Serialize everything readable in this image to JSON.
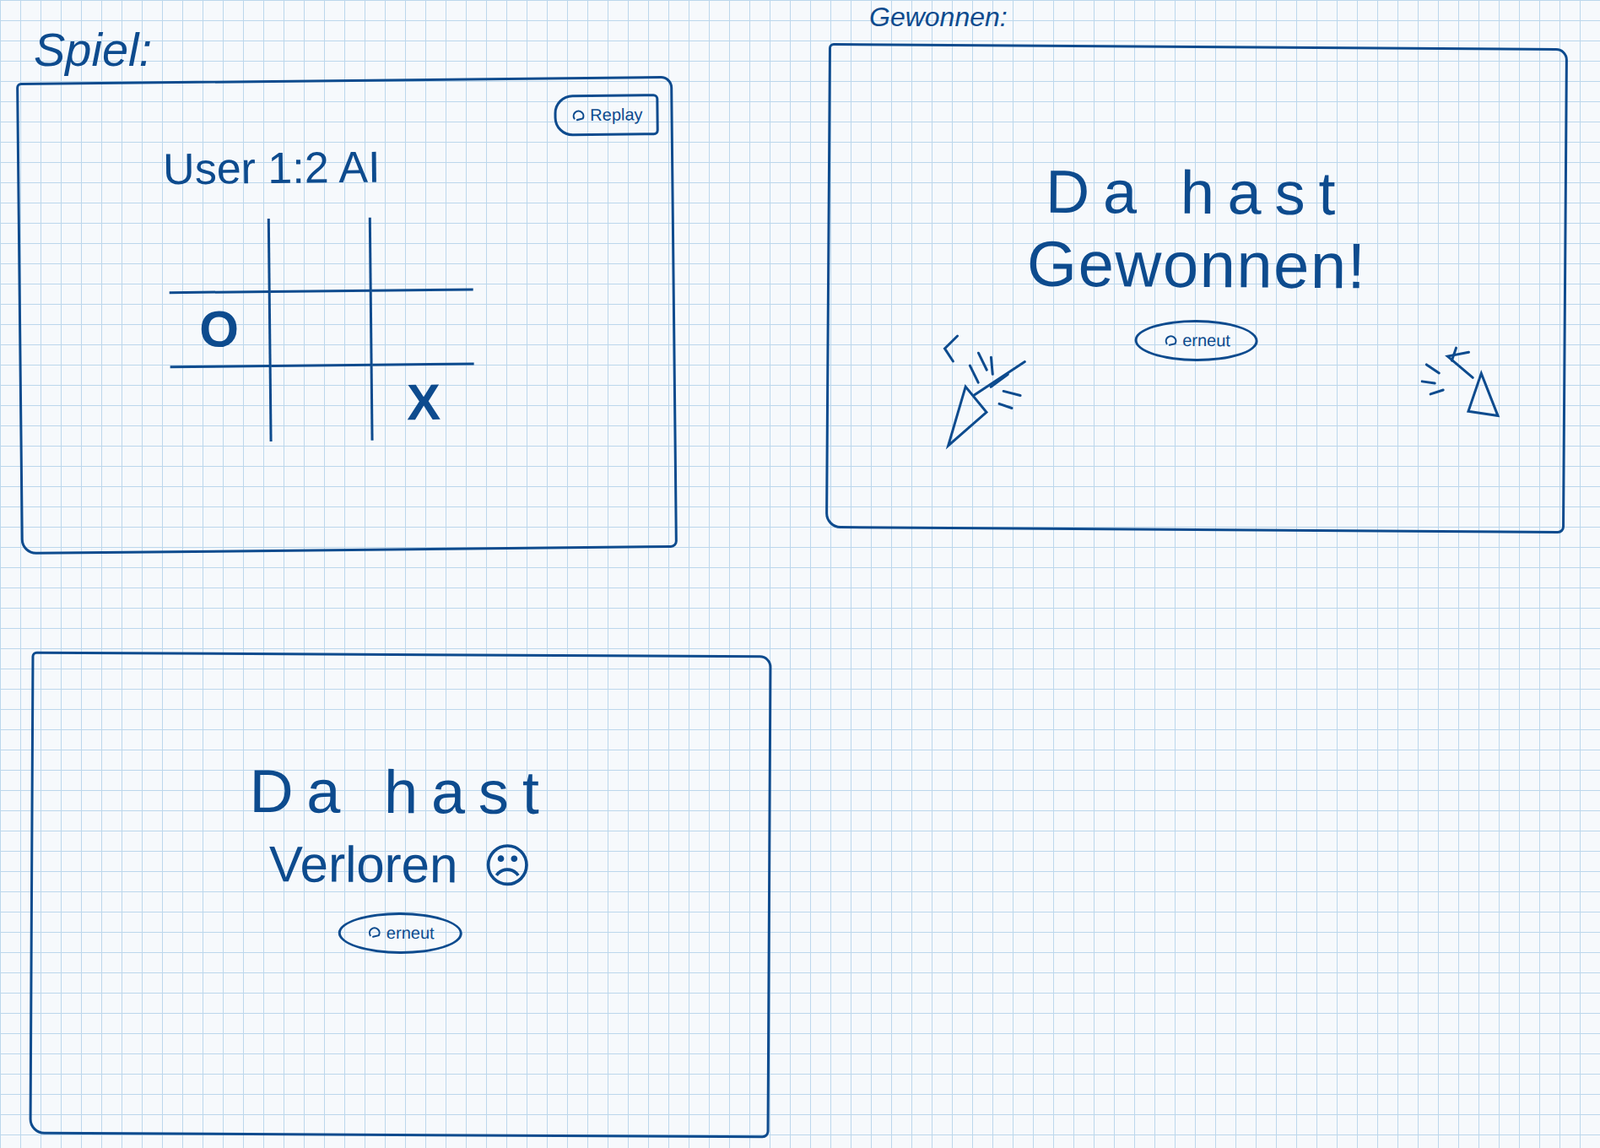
{
  "game_screen": {
    "label": "Spiel:",
    "replay_button": "Replay",
    "score": "User 1:2 AI",
    "board": [
      [
        "",
        "",
        ""
      ],
      [
        "O",
        "",
        ""
      ],
      [
        "",
        "",
        "X"
      ]
    ]
  },
  "win_screen": {
    "label": "Gewonnen:",
    "line1": "Da hast",
    "line2": "Gewonnen!",
    "button": "erneut"
  },
  "lose_screen": {
    "line1": "Da hast",
    "line2": "Verloren",
    "face": "☹",
    "button": "erneut"
  }
}
